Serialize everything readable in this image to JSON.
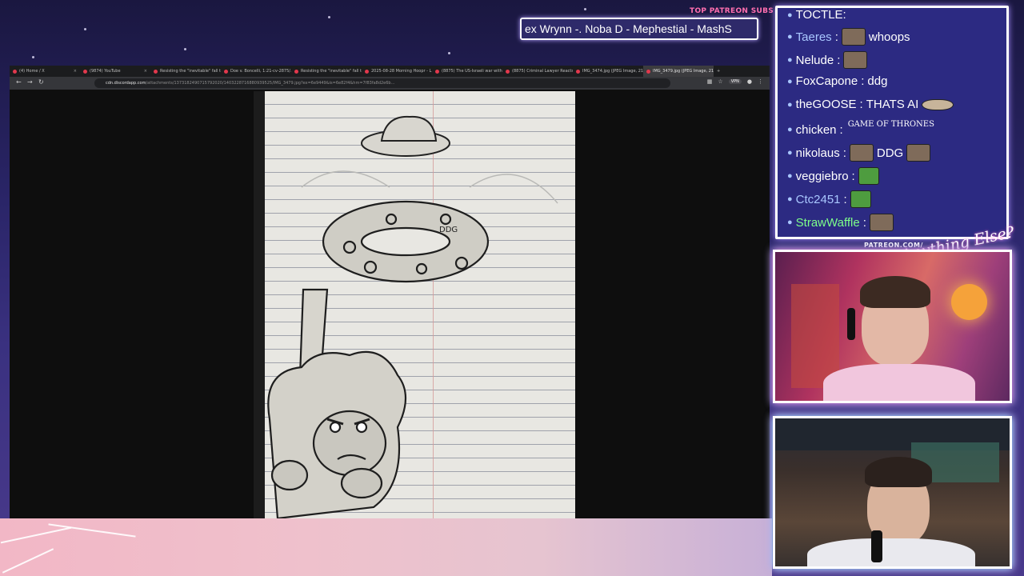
{
  "overlay": {
    "top_patreon_title": "TOP PATREON SUBS",
    "top_patreon_names": "ex Wrynn -. Noba D - Mephestial - MashS",
    "patreon_url": "PATREON.COM/",
    "logo_text": "Anything Else?"
  },
  "browser": {
    "tabs": [
      {
        "label": "(4) Home / X",
        "active": false
      },
      {
        "label": "(9874) YouTube",
        "active": false
      },
      {
        "label": "Resisting the \"inevitable\" fall to",
        "active": false
      },
      {
        "label": "Doe v. Boncelli, 1:21-cv-2875/...",
        "active": false
      },
      {
        "label": "Resisting the \"inevitable\" fall to",
        "active": false
      },
      {
        "label": "2025-08-28 Morning Hoopr - L",
        "active": false
      },
      {
        "label": "(8875) The US-Israeli war with I",
        "active": false
      },
      {
        "label": "(8875) Criminal Lawyer Reacts",
        "active": false
      },
      {
        "label": "IMG_3474.jpg (JPEG Image, 2160 ×",
        "active": false
      },
      {
        "label": "IMG_3479.jpg (JPEG Image, 2160 ×",
        "active": true
      }
    ],
    "new_tab": "+",
    "url_host": "cdn.discordapp.com",
    "url_path": "/attachments/1373182490715792020/1403228716880939525/IMG_3479.jpg?ex=6e9449&is=6e82f4&hm=7f83fa8d2e6b...",
    "vpn_label": "VPN"
  },
  "chat": {
    "messages": [
      {
        "user": "Taeres",
        "text": "whoops",
        "color": "#a9c7ff",
        "emote_before": true
      },
      {
        "user": "Nelude",
        "text": "",
        "color": "#ffffff",
        "emote_before": true
      },
      {
        "user": "FoxCapone",
        "text": "ddg",
        "color": "#ffffff",
        "emote_before": false
      },
      {
        "user": "theGOOSE",
        "text": "THATS AI",
        "color": "#ffffff",
        "emote_before": false
      },
      {
        "user": "chicken",
        "text": "",
        "color": "#ffffff",
        "emote_before": false
      },
      {
        "user": "nikolaus",
        "text": "DDG",
        "color": "#ffffff",
        "emote_before": true
      },
      {
        "user": "veggiebro",
        "text": "",
        "color": "#ffffff",
        "emote_before": false
      },
      {
        "user": "Ctc2451",
        "text": "",
        "color": "#a9c7ff",
        "emote_before": false
      },
      {
        "user": "StrawWaffle",
        "text": "",
        "color": "#7dff8a",
        "emote_before": false
      }
    ],
    "emote_game_of_thrones": "GAME OF THRONES",
    "top_partial_user": "TOCTLE:"
  },
  "drawing": {
    "donut_text": "DDG"
  }
}
